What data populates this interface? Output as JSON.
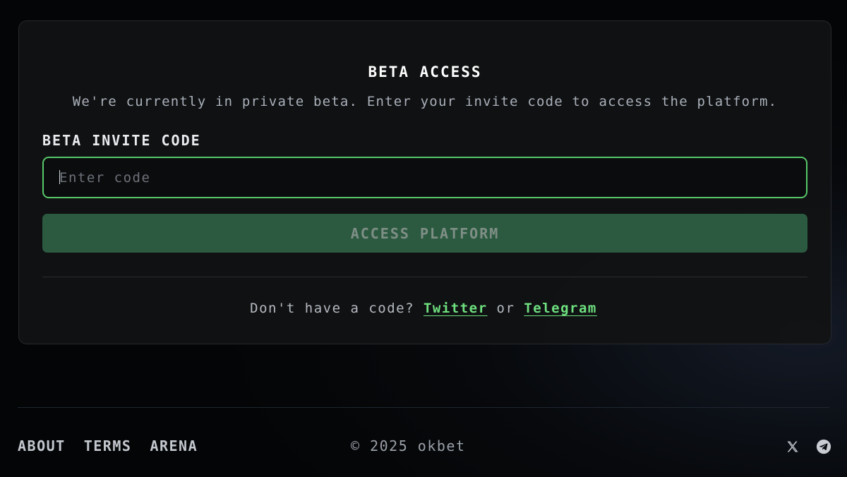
{
  "card": {
    "title": "BETA ACCESS",
    "description": "We're currently in private beta. Enter your invite code to access the platform.",
    "field_label": "BETA INVITE CODE",
    "input_placeholder": "Enter code",
    "input_value": "",
    "submit_label": "ACCESS PLATFORM",
    "no_code_prefix": "Don't have a code?",
    "twitter_link": "Twitter",
    "or_text": "or",
    "telegram_link": "Telegram"
  },
  "footer": {
    "nav": [
      "ABOUT",
      "TERMS",
      "ARENA"
    ],
    "copyright": "© 2025 okbet",
    "social_icons": [
      "x-icon",
      "telegram-icon"
    ]
  },
  "colors": {
    "accent": "#57c86a",
    "link": "#6ee07f",
    "button_bg": "#2c5a41",
    "card_bg": "#111214"
  }
}
